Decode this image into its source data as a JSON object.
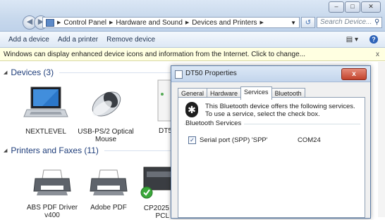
{
  "window": {
    "breadcrumbs": [
      "Control Panel",
      "Hardware and Sound",
      "Devices and Printers"
    ],
    "search_placeholder": "Search Device..."
  },
  "toolbar": {
    "add_device": "Add a device",
    "add_printer": "Add a printer",
    "remove_device": "Remove device"
  },
  "infobar": {
    "text": "Windows can display enhanced device icons and information from the Internet. Click to change...",
    "close": "x"
  },
  "devices": {
    "header": "Devices (3)",
    "items": [
      {
        "label": "NEXTLEVEL",
        "icon": "laptop-icon"
      },
      {
        "label": "USB-PS/2 Optical Mouse",
        "icon": "mouse-icon"
      },
      {
        "label": "DT5",
        "icon": "device-icon"
      }
    ]
  },
  "printers": {
    "header": "Printers and Faxes (11)",
    "items": [
      {
        "label": "ABS PDF Driver v400",
        "icon": "printer-icon"
      },
      {
        "label": "Adobe PDF",
        "icon": "printer-icon"
      },
      {
        "label": "CP2025 PCL",
        "icon": "printer-icon"
      }
    ]
  },
  "dialog": {
    "title": "DT50 Properties",
    "close": "x",
    "tabs": [
      "General",
      "Hardware",
      "Services",
      "Bluetooth"
    ],
    "active_tab": "Services",
    "description": "This Bluetooth device offers the following services. To use a service, select the check box.",
    "group_label": "Bluetooth Services",
    "services": [
      {
        "name": "Serial port (SPP) 'SPP'",
        "port": "COM24",
        "checked": true
      }
    ]
  },
  "colors": {
    "accent": "#1e3d7a",
    "infobar": "#ffffe1",
    "close_red": "#c2432d"
  }
}
